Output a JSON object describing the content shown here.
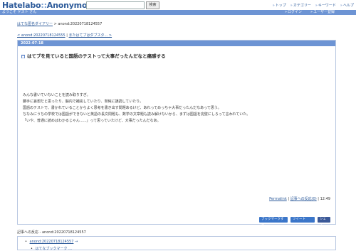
{
  "header": {
    "logo_main": "Hatelabo",
    "logo_sep": "::",
    "logo_sub": "AnonymousDiary",
    "search_placeholder": "",
    "search_button": "検索",
    "nav": [
      "トップ",
      "カテゴリー",
      "キーワード",
      "ヘルプ"
    ]
  },
  "bar": {
    "welcome": "ようこそ ゲスト さん",
    "links": [
      "ログイン",
      "ユーザー登録"
    ]
  },
  "breadcrumb": {
    "home": "はてな匿名ダイアリー",
    "sep": " > ",
    "current": "anond:20220718124557"
  },
  "pager": {
    "prev": "< anond:20220718124555",
    "divider": " | ",
    "next": "またはてブはダブスタ... >"
  },
  "entry": {
    "date": "2022-07-18",
    "mark": "■",
    "title": "はてブを見ていると国語のテストって大事だったんだなと痛感する",
    "paragraphs": [
      "みんな書いていないことを読み取りすぎ。",
      "勝手に妄想だと思ったり、脳内で補完していたり、単純に誤読していたり。",
      "国語のテストで、書かれていることからよく思考を書き出す問題あるけど、あれってめっちゃ大事だったんだなあって思う。",
      "ちなみにうちの学校では国語ができないと英語の長文問題も、数学の文章題も読み解けないから、まずは国語を完璧にしろって言われていた。",
      "「いや、普通に読めばわかるじゃん......」って思っていたけど、大事だったんだなあ。"
    ],
    "permalink": "Permalink",
    "refs_link": "記事への反応(0)",
    "time": "12:49",
    "share": {
      "bookmark": "ブックマークする",
      "tweet": "ツイート",
      "facebook": "シェア"
    }
  },
  "refs": {
    "title": "記事への反応 - anond:20220718124557",
    "item1": "anond:20220718124557",
    "item1_arrow": " →",
    "item2": "はてなブックマーク ..."
  }
}
